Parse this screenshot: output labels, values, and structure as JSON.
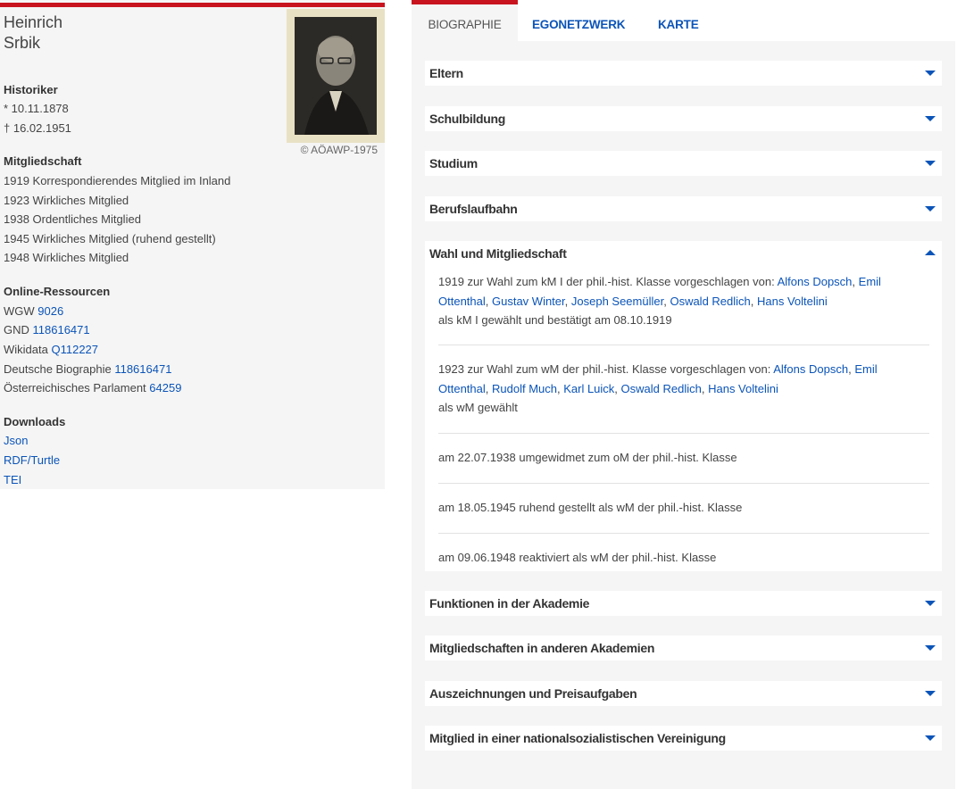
{
  "person": {
    "first_name": "Heinrich",
    "last_name": "Srbik",
    "profession": "Historiker",
    "born": "* 10.11.1878",
    "died": "† 16.02.1951",
    "photo_credit": "© AÖAWP-1975"
  },
  "membership": {
    "heading": "Mitgliedschaft",
    "items": [
      "1919 Korrespondierendes Mitglied im Inland",
      "1923 Wirkliches Mitglied",
      "1938 Ordentliches Mitglied",
      "1945 Wirkliches Mitglied (ruhend gestellt)",
      "1948 Wirkliches Mitglied"
    ]
  },
  "resources": {
    "heading": "Online-Ressourcen",
    "items": [
      {
        "label": "WGW",
        "value": "9026"
      },
      {
        "label": "GND",
        "value": "118616471"
      },
      {
        "label": "Wikidata",
        "value": "Q112227"
      },
      {
        "label": "Deutsche Biographie",
        "value": "118616471"
      },
      {
        "label": "Österreichisches Parlament",
        "value": "64259"
      }
    ]
  },
  "downloads": {
    "heading": "Downloads",
    "items": [
      "Json",
      "RDF/Turtle",
      "TEI"
    ]
  },
  "tabs": [
    {
      "label": "BIOGRAPHIE",
      "active": true
    },
    {
      "label": "EGONETZWERK",
      "active": false
    },
    {
      "label": "KARTE",
      "active": false
    }
  ],
  "sections": [
    {
      "title": "Eltern",
      "expanded": false
    },
    {
      "title": "Schulbildung",
      "expanded": false
    },
    {
      "title": "Studium",
      "expanded": false
    },
    {
      "title": "Berufslaufbahn",
      "expanded": false
    },
    {
      "title": "Wahl und Mitgliedschaft",
      "expanded": true
    },
    {
      "title": "Funktionen in der Akademie",
      "expanded": false
    },
    {
      "title": "Mitgliedschaften in anderen Akademien",
      "expanded": false
    },
    {
      "title": "Auszeichnungen und Preisaufgaben",
      "expanded": false
    },
    {
      "title": "Mitglied in einer nationalsozialistischen Vereinigung",
      "expanded": false
    }
  ],
  "election": {
    "entry1": {
      "prefix": "1919 zur Wahl zum kM I der phil.-hist. Klasse vorgeschlagen von: ",
      "proposers": [
        "Alfons Dopsch",
        "Emil Ottenthal",
        "Gustav Winter",
        "Joseph Seemüller",
        "Oswald Redlich",
        "Hans Voltelini"
      ],
      "result": "als kM I gewählt und bestätigt am 08.10.1919"
    },
    "entry2": {
      "prefix": "1923 zur Wahl zum wM der phil.-hist. Klasse vorgeschlagen von: ",
      "proposers": [
        "Alfons Dopsch",
        "Emil Ottenthal",
        "Rudolf Much",
        "Karl Luick",
        "Oswald Redlich",
        "Hans Voltelini"
      ],
      "result": "als wM gewählt"
    },
    "entry3": "am 22.07.1938 umgewidmet zum oM der phil.-hist. Klasse",
    "entry4": "am 18.05.1945 ruhend gestellt als wM der phil.-hist. Klasse",
    "entry5": "am 09.06.1948 reaktiviert als wM der phil.-hist. Klasse"
  },
  "colors": {
    "accent": "#c8141e",
    "link": "#0b54b8",
    "panel": "#f5f5f5"
  },
  "icons": {
    "expand": "caret-down-icon",
    "collapse": "caret-up-icon"
  }
}
